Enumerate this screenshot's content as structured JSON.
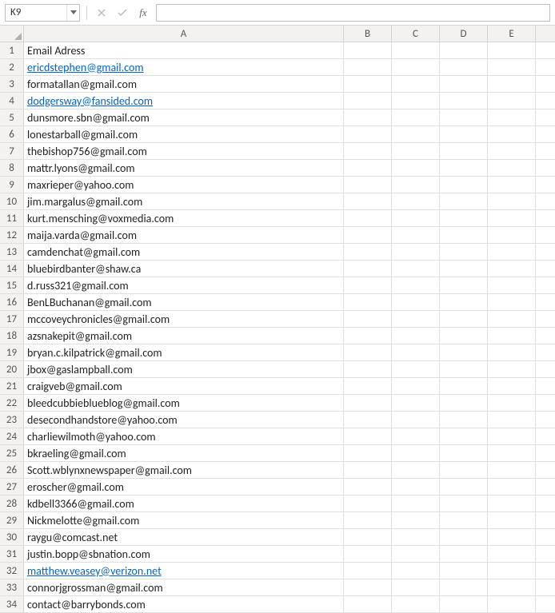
{
  "nameBox": {
    "value": "K9"
  },
  "fx": {
    "label": "fx"
  },
  "formulaBar": {
    "value": ""
  },
  "columns": [
    {
      "label": "A",
      "class": "col-A"
    },
    {
      "label": "B",
      "class": "col-B"
    },
    {
      "label": "C",
      "class": "col-C"
    },
    {
      "label": "D",
      "class": "col-D"
    },
    {
      "label": "E",
      "class": "col-E"
    }
  ],
  "rows": [
    {
      "n": 1,
      "value": "Email Adress",
      "link": false
    },
    {
      "n": 2,
      "value": "ericdstephen@gmail.com",
      "link": true
    },
    {
      "n": 3,
      "value": "formatallan@gmail.com",
      "link": false
    },
    {
      "n": 4,
      "value": "dodgersway@fansided.com",
      "link": true
    },
    {
      "n": 5,
      "value": "dunsmore.sbn@gmail.com",
      "link": false
    },
    {
      "n": 6,
      "value": "lonestarball@gmail.com",
      "link": false
    },
    {
      "n": 7,
      "value": "thebishop756@gmail.com",
      "link": false
    },
    {
      "n": 8,
      "value": "mattr.lyons@gmail.com",
      "link": false
    },
    {
      "n": 9,
      "value": "maxrieper@yahoo.com",
      "link": false
    },
    {
      "n": 10,
      "value": "jim.margalus@gmail.com",
      "link": false
    },
    {
      "n": 11,
      "value": "kurt.mensching@voxmedia.com",
      "link": false
    },
    {
      "n": 12,
      "value": "maija.varda@gmail.com",
      "link": false
    },
    {
      "n": 13,
      "value": "camdenchat@gmail.com",
      "link": false
    },
    {
      "n": 14,
      "value": "bluebirdbanter@shaw.ca",
      "link": false
    },
    {
      "n": 15,
      "value": "d.russ321@gmail.com",
      "link": false
    },
    {
      "n": 16,
      "value": "BenLBuchanan@gmail.com",
      "link": false
    },
    {
      "n": 17,
      "value": "mccoveychronicles@gmail.com",
      "link": false
    },
    {
      "n": 18,
      "value": "azsnakepit@gmail.com",
      "link": false
    },
    {
      "n": 19,
      "value": "bryan.c.kilpatrick@gmail.com",
      "link": false
    },
    {
      "n": 20,
      "value": "jbox@gaslampball.com",
      "link": false
    },
    {
      "n": 21,
      "value": "craigveb@gmail.com",
      "link": false
    },
    {
      "n": 22,
      "value": "bleedcubbieblueblog@gmail.com",
      "link": false
    },
    {
      "n": 23,
      "value": "desecondhandstore@yahoo.com",
      "link": false
    },
    {
      "n": 24,
      "value": "charliewilmoth@yahoo.com",
      "link": false
    },
    {
      "n": 25,
      "value": "bkraeling@gmail.com",
      "link": false
    },
    {
      "n": 26,
      "value": "Scott.wblynxnewspaper@gmail.com",
      "link": false
    },
    {
      "n": 27,
      "value": "eroscher@gmail.com",
      "link": false
    },
    {
      "n": 28,
      "value": "kdbell3366@gmail.com",
      "link": false
    },
    {
      "n": 29,
      "value": "Nickmelotte@gmail.com",
      "link": false
    },
    {
      "n": 30,
      "value": "raygu@comcast.net",
      "link": false
    },
    {
      "n": 31,
      "value": "justin.bopp@sbnation.com",
      "link": false
    },
    {
      "n": 32,
      "value": "matthew.veasey@verizon.net",
      "link": true
    },
    {
      "n": 33,
      "value": "connorjgrossman@gmail.com",
      "link": false
    },
    {
      "n": 34,
      "value": "contact@barrybonds.com",
      "link": false
    }
  ]
}
